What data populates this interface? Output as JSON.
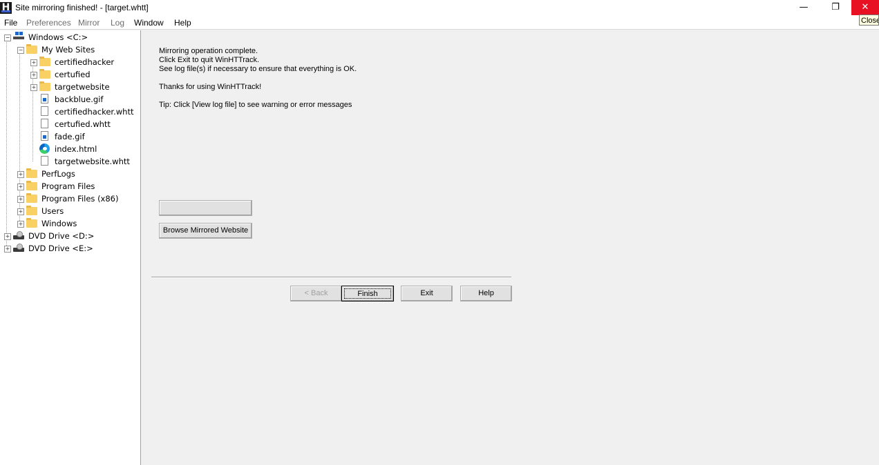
{
  "window": {
    "title": "Site mirroring finished! - [target.whtt]",
    "app_icon_letter": "H",
    "minimize_glyph": "—",
    "maximize_glyph": "❐",
    "close_glyph": "✕",
    "close_tooltip": "Close"
  },
  "menu": {
    "file": "File",
    "preferences": "Preferences",
    "mirror": "Mirror",
    "log": "Log",
    "window": "Window",
    "help": "Help"
  },
  "tree": {
    "root": "Windows <C:>",
    "my_web_sites": "My Web Sites",
    "certifiedhacker": "certifiedhacker",
    "certufied": "certufied",
    "targetwebsite": "targetwebsite",
    "backblue": "backblue.gif",
    "certifiedhacker_whtt": "certifiedhacker.whtt",
    "certufied_whtt": "certufied.whtt",
    "fade": "fade.gif",
    "index": "index.html",
    "targetwebsite_whtt": "targetwebsite.whtt",
    "perflogs": "PerfLogs",
    "program_files": "Program Files",
    "program_files_x86": "Program Files (x86)",
    "users": "Users",
    "windows": "Windows",
    "dvd_d": "DVD Drive <D:>",
    "dvd_e": "DVD Drive <E:>",
    "expand_glyph": "+",
    "collapse_glyph": "−"
  },
  "main": {
    "line1": "Mirroring operation complete.",
    "line2": "Click Exit to quit WinHTTrack.",
    "line3": "See log file(s) if necessary to ensure that everything is OK.",
    "line4": "Thanks for using WinHTTrack!",
    "line5": "Tip: Click [View log file] to see warning or error messages",
    "blank_button": "",
    "browse_button": "Browse Mirrored Website",
    "back_button": "< Back",
    "finish_button": "Finish",
    "exit_button": "Exit",
    "help_button": "Help"
  }
}
